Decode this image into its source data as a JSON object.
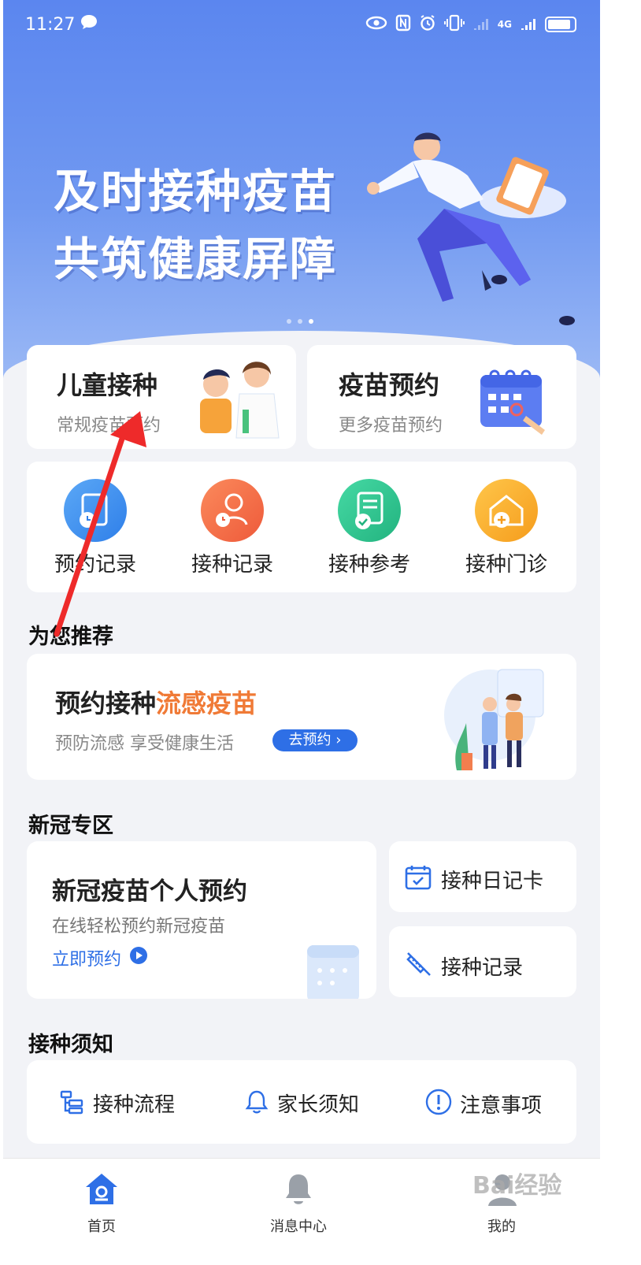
{
  "status_bar": {
    "time": "11:27",
    "network": "4G"
  },
  "banner": {
    "line1": "及时接种疫苗",
    "line2": "共筑健康屏障",
    "dots": 3,
    "active_dot": 3
  },
  "cards": {
    "child": {
      "title": "儿童接种",
      "subtitle": "常规疫苗预约"
    },
    "vaccine": {
      "title": "疫苗预约",
      "subtitle": "更多疫苗预约"
    }
  },
  "quick_actions": [
    {
      "label": "预约记录",
      "icon": "calendar-clock-icon",
      "color": "#3f8ef0"
    },
    {
      "label": "接种记录",
      "icon": "person-clock-icon",
      "color": "#f36a45"
    },
    {
      "label": "接种参考",
      "icon": "document-check-icon",
      "color": "#2fc28f"
    },
    {
      "label": "接种门诊",
      "icon": "clinic-house-icon",
      "color": "#f7a92a"
    }
  ],
  "recommend": {
    "section_title": "为您推荐",
    "title_main": "预约接种",
    "title_highlight": "流感疫苗",
    "subtitle": "预防流感 享受健康生活",
    "button": "去预约"
  },
  "covid": {
    "section_title": "新冠专区",
    "main_title": "新冠疫苗个人预约",
    "main_subtitle": "在线轻松预约新冠疫苗",
    "main_link": "立即预约",
    "side_items": [
      {
        "label": "接种日记卡",
        "icon": "calendar-check-icon"
      },
      {
        "label": "接种记录",
        "icon": "syringe-icon"
      }
    ]
  },
  "notice": {
    "section_title": "接种须知",
    "items": [
      {
        "label": "接种流程",
        "icon": "flow-chart-icon"
      },
      {
        "label": "家长须知",
        "icon": "bell-icon"
      },
      {
        "label": "注意事项",
        "icon": "exclamation-circle-icon"
      }
    ]
  },
  "bottom_nav": [
    {
      "label": "首页",
      "icon": "home-icon",
      "active": true
    },
    {
      "label": "消息中心",
      "icon": "bell-icon",
      "active": false
    },
    {
      "label": "我的",
      "icon": "user-icon",
      "active": false
    }
  ],
  "watermark": "Bai经验",
  "colors": {
    "primary": "#2e6fe6",
    "highlight": "#f07a36",
    "annotation_arrow": "#ee2a2a"
  }
}
